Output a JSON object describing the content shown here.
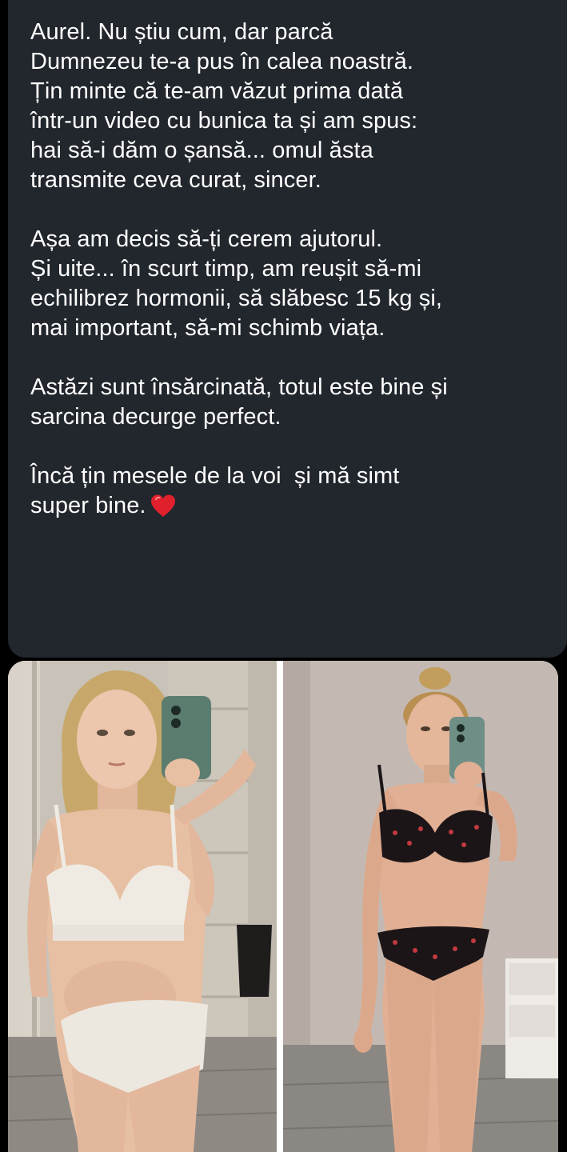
{
  "message": {
    "paragraphs": [
      "Aurel. Nu știu cum, dar parcă\nDumnezeu te-a pus în calea noastră.\nȚin minte că te-am văzut prima dată\nîntr-un video cu bunica ta și am spus:\nhai să-i dăm o șansă... omul ăsta\ntransmite ceva curat, sincer.",
      "Așa am decis să-ți cerem ajutorul.\nȘi uite... în scurt timp, am reușit să-mi\nechilibrez hormonii, să slăbesc 15 kg și,\nmai important, să-mi schimb viața.",
      "Astăzi sunt însărcinată, totul este bine și\nsarcina decurge perfect."
    ],
    "last_paragraph": "Încă țin mesele de la voi  și mă simt\nsuper bine.",
    "emoji": "red-heart-icon"
  },
  "photos": [
    {
      "name": "before-photo"
    },
    {
      "name": "after-photo"
    }
  ],
  "colors": {
    "background": "#000000",
    "bubble": "#22262d",
    "text": "#ffffff",
    "heart": "#e0202c"
  }
}
